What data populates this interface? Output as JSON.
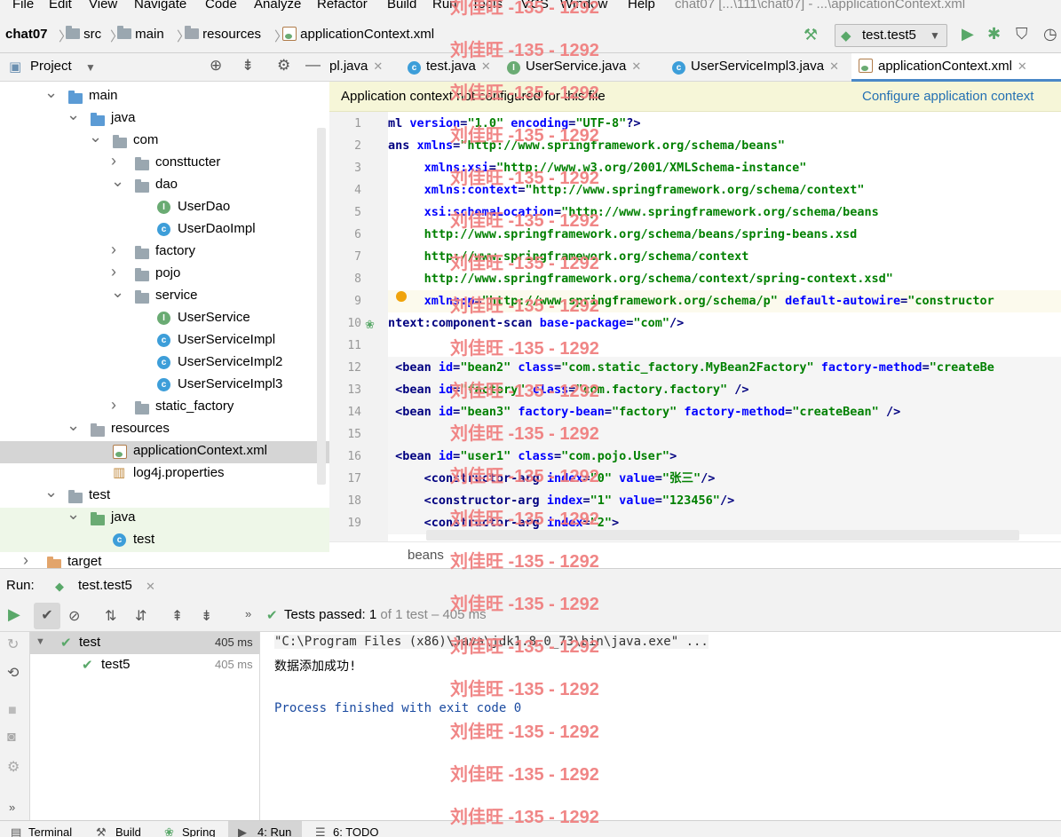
{
  "menu": [
    "File",
    "Edit",
    "View",
    "Navigate",
    "Code",
    "Analyze",
    "Refactor",
    "Build",
    "Run",
    "Tools",
    "VCS",
    "Window",
    "Help"
  ],
  "window_title": "chat07 [...\\111\\chat07] - ...\\applicationContext.xml",
  "breadcrumb": {
    "project": "chat07",
    "p1": "src",
    "p2": "main",
    "p3": "resources",
    "file": "applicationContext.xml"
  },
  "run_config": "test.test5",
  "project_panel": {
    "title": "Project"
  },
  "tree": [
    {
      "label": "main",
      "kind": "folder-blue",
      "depth": 2,
      "arrow": "down"
    },
    {
      "label": "java",
      "kind": "folder-blue",
      "depth": 3,
      "arrow": "down"
    },
    {
      "label": "com",
      "kind": "folder",
      "depth": 4,
      "arrow": "down"
    },
    {
      "label": "consttucter",
      "kind": "folder",
      "depth": 5,
      "arrow": "right"
    },
    {
      "label": "dao",
      "kind": "folder",
      "depth": 5,
      "arrow": "down"
    },
    {
      "label": "UserDao",
      "kind": "interface",
      "depth": 6,
      "arrow": ""
    },
    {
      "label": "UserDaoImpl",
      "kind": "class",
      "depth": 6,
      "arrow": ""
    },
    {
      "label": "factory",
      "kind": "folder",
      "depth": 5,
      "arrow": "right"
    },
    {
      "label": "pojo",
      "kind": "folder",
      "depth": 5,
      "arrow": "right"
    },
    {
      "label": "service",
      "kind": "folder",
      "depth": 5,
      "arrow": "down"
    },
    {
      "label": "UserService",
      "kind": "interface",
      "depth": 6,
      "arrow": ""
    },
    {
      "label": "UserServiceImpl",
      "kind": "class",
      "depth": 6,
      "arrow": ""
    },
    {
      "label": "UserServiceImpl2",
      "kind": "class",
      "depth": 6,
      "arrow": ""
    },
    {
      "label": "UserServiceImpl3",
      "kind": "class",
      "depth": 6,
      "arrow": ""
    },
    {
      "label": "static_factory",
      "kind": "folder",
      "depth": 5,
      "arrow": "right"
    },
    {
      "label": "resources",
      "kind": "folder-grey",
      "depth": 3,
      "arrow": "down"
    },
    {
      "label": "applicationContext.xml",
      "kind": "xml",
      "depth": 4,
      "arrow": "",
      "selected": true
    },
    {
      "label": "log4j.properties",
      "kind": "props",
      "depth": 4,
      "arrow": ""
    },
    {
      "label": "test",
      "kind": "folder",
      "depth": 2,
      "arrow": "down"
    },
    {
      "label": "java",
      "kind": "folder-green",
      "depth": 3,
      "arrow": "down",
      "green": true
    },
    {
      "label": "test",
      "kind": "class",
      "depth": 4,
      "arrow": "",
      "green": true
    },
    {
      "label": "target",
      "kind": "folder-orange",
      "depth": 1,
      "arrow": "right"
    }
  ],
  "tabs": [
    {
      "label": "pl.java",
      "icon": "",
      "active": false
    },
    {
      "label": "test.java",
      "icon": "class",
      "active": false
    },
    {
      "label": "UserService.java",
      "icon": "interface",
      "active": false
    },
    {
      "label": "UserServiceImpl3.java",
      "icon": "class",
      "active": false
    },
    {
      "label": "applicationContext.xml",
      "icon": "xml",
      "active": true
    }
  ],
  "banner": {
    "message": "Application context not configured for this file",
    "action": "Configure application context"
  },
  "code_lines": [
    {
      "n": "1",
      "segs": [
        [
          "tg",
          "ml "
        ],
        [
          "at",
          "version"
        ],
        [
          "tg",
          "="
        ],
        [
          "st",
          "\"1.0\""
        ],
        [
          "tg",
          " "
        ],
        [
          "at",
          "encoding"
        ],
        [
          "tg",
          "="
        ],
        [
          "st",
          "\"UTF-8\""
        ],
        [
          "tg",
          "?>"
        ]
      ]
    },
    {
      "n": "2",
      "segs": [
        [
          "tg",
          "ans "
        ],
        [
          "at",
          "xmlns"
        ],
        [
          "tg",
          "="
        ],
        [
          "st",
          "\"http://www.springframework.org/schema/beans\""
        ]
      ]
    },
    {
      "n": "3",
      "segs": [
        [
          "tg",
          "     "
        ],
        [
          "at",
          "xmlns:xsi"
        ],
        [
          "tg",
          "="
        ],
        [
          "st",
          "\"http://www.w3.org/2001/XMLSchema-instance\""
        ]
      ]
    },
    {
      "n": "4",
      "segs": [
        [
          "tg",
          "     "
        ],
        [
          "at",
          "xmlns:context"
        ],
        [
          "tg",
          "="
        ],
        [
          "st",
          "\"http://www.springframework.org/schema/context\""
        ]
      ]
    },
    {
      "n": "5",
      "segs": [
        [
          "tg",
          "     "
        ],
        [
          "at",
          "xsi:schemaLocation"
        ],
        [
          "tg",
          "="
        ],
        [
          "st",
          "\"http://www.springframework.org/schema/beans"
        ]
      ]
    },
    {
      "n": "6",
      "segs": [
        [
          "st",
          "     http://www.springframework.org/schema/beans/spring-beans.xsd"
        ]
      ]
    },
    {
      "n": "7",
      "segs": [
        [
          "st",
          "     http://www.springframework.org/schema/context"
        ]
      ]
    },
    {
      "n": "8",
      "segs": [
        [
          "st",
          "     http://www.springframework.org/schema/context/spring-context.xsd\""
        ]
      ]
    },
    {
      "n": "9",
      "segs": [
        [
          "tg",
          "     "
        ],
        [
          "at",
          "xmlns:p"
        ],
        [
          "tg",
          "="
        ],
        [
          "st",
          "\"http://www.springframework.org/schema/p\""
        ],
        [
          "tg",
          " "
        ],
        [
          "at",
          "default-autowire"
        ],
        [
          "tg",
          "="
        ],
        [
          "st",
          "\"constructor"
        ]
      ]
    },
    {
      "n": "10",
      "segs": [
        [
          "tg",
          "ntext:component-scan "
        ],
        [
          "at",
          "base-package"
        ],
        [
          "tg",
          "="
        ],
        [
          "st",
          "\"com\""
        ],
        [
          "tg",
          "/>"
        ]
      ]
    },
    {
      "n": "11",
      "segs": []
    },
    {
      "n": "12",
      "segs": [
        [
          "tg",
          " <bean "
        ],
        [
          "at",
          "id"
        ],
        [
          "tg",
          "="
        ],
        [
          "st",
          "\"bean2\""
        ],
        [
          "tg",
          " "
        ],
        [
          "at",
          "class"
        ],
        [
          "tg",
          "="
        ],
        [
          "st",
          "\"com.static_factory.MyBean2Factory\""
        ],
        [
          "tg",
          " "
        ],
        [
          "at",
          "factory-method"
        ],
        [
          "tg",
          "="
        ],
        [
          "st",
          "\"createBe"
        ]
      ]
    },
    {
      "n": "13",
      "segs": [
        [
          "tg",
          " <bean "
        ],
        [
          "at",
          "id"
        ],
        [
          "tg",
          "="
        ],
        [
          "st",
          "\"factory\""
        ],
        [
          "tg",
          " "
        ],
        [
          "at",
          "class"
        ],
        [
          "tg",
          "="
        ],
        [
          "st",
          "\"com.factory.factory\""
        ],
        [
          "tg",
          " />"
        ]
      ]
    },
    {
      "n": "14",
      "segs": [
        [
          "tg",
          " <bean "
        ],
        [
          "at",
          "id"
        ],
        [
          "tg",
          "="
        ],
        [
          "st",
          "\"bean3\""
        ],
        [
          "tg",
          " "
        ],
        [
          "at",
          "factory-bean"
        ],
        [
          "tg",
          "="
        ],
        [
          "st",
          "\"factory\""
        ],
        [
          "tg",
          " "
        ],
        [
          "at",
          "factory-method"
        ],
        [
          "tg",
          "="
        ],
        [
          "st",
          "\"createBean\""
        ],
        [
          "tg",
          " />"
        ]
      ]
    },
    {
      "n": "15",
      "segs": []
    },
    {
      "n": "16",
      "segs": [
        [
          "tg",
          " <bean "
        ],
        [
          "at",
          "id"
        ],
        [
          "tg",
          "="
        ],
        [
          "st",
          "\"user1\""
        ],
        [
          "tg",
          " "
        ],
        [
          "at",
          "class"
        ],
        [
          "tg",
          "="
        ],
        [
          "st",
          "\"com.pojo.User\""
        ],
        [
          "tg",
          ">"
        ]
      ]
    },
    {
      "n": "17",
      "segs": [
        [
          "tg",
          "     <constructor-arg "
        ],
        [
          "at",
          "index"
        ],
        [
          "tg",
          "="
        ],
        [
          "st",
          "\"0\""
        ],
        [
          "tg",
          " "
        ],
        [
          "at",
          "value"
        ],
        [
          "tg",
          "="
        ],
        [
          "st",
          "\"张三\""
        ],
        [
          "tg",
          "/>"
        ]
      ]
    },
    {
      "n": "18",
      "segs": [
        [
          "tg",
          "     <constructor-arg "
        ],
        [
          "at",
          "index"
        ],
        [
          "tg",
          "="
        ],
        [
          "st",
          "\"1\""
        ],
        [
          "tg",
          " "
        ],
        [
          "at",
          "value"
        ],
        [
          "tg",
          "="
        ],
        [
          "st",
          "\"123456\""
        ],
        [
          "tg",
          "/>"
        ]
      ]
    },
    {
      "n": "19",
      "segs": [
        [
          "tg",
          "     <constructor-arg "
        ],
        [
          "at",
          "index"
        ],
        [
          "tg",
          "="
        ],
        [
          "st",
          "\"2\""
        ],
        [
          "tg",
          ">"
        ]
      ]
    }
  ],
  "editor_footer": "beans",
  "run_panel": {
    "label": "Run:",
    "tab": "test.test5",
    "passed": "Tests passed:",
    "passed_count": "1",
    "passed_rest": "of 1 test – 405 ms"
  },
  "test_tree": [
    {
      "name": "test",
      "time": "405 ms"
    },
    {
      "name": "test5",
      "time": "405 ms"
    }
  ],
  "console": [
    {
      "text": "\"C:\\Program Files (x86)\\Java\\jdk1.8.0_73\\bin\\java.exe\" ...",
      "color": "#333"
    },
    {
      "text": "数据添加成功!",
      "color": "#000"
    },
    {
      "text": "",
      "color": "#000"
    },
    {
      "text": "Process finished with exit code 0",
      "color": "#1a4aa0"
    }
  ],
  "statusbar": [
    "Terminal",
    "Build",
    "Spring",
    "4: Run",
    "6: TODO"
  ],
  "watermark": "刘佳旺 -135 - 1292",
  "colors": {
    "accent": "#4a88c7",
    "pass_green": "#59a869",
    "run_green": "#59a869",
    "watermark": "#f08080",
    "selection": "#d5d5d5",
    "banner": "#f6f6d8"
  }
}
